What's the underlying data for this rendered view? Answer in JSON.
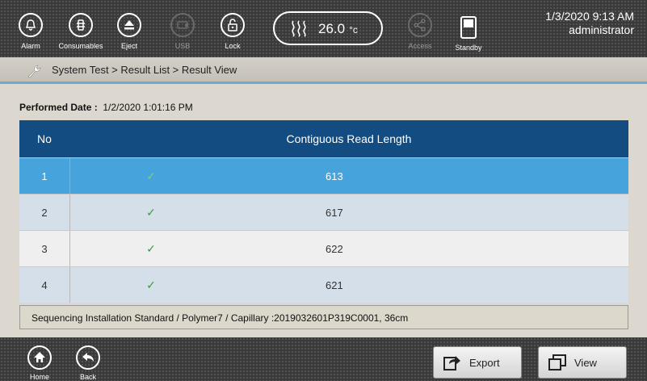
{
  "topbar": {
    "alarm_label": "Alarm",
    "consumables_label": "Consumables",
    "eject_label": "Eject",
    "usb_label": "USB",
    "lock_label": "Lock",
    "temperature_value": "26.0",
    "temperature_unit": "°c",
    "access_label": "Access",
    "standby_label": "Standby",
    "date_time": "1/3/2020 9:13 AM",
    "user": "administrator"
  },
  "breadcrumb": {
    "text": "System Test > Result List > Result View"
  },
  "performed": {
    "label": "Performed Date :",
    "value": "1/2/2020 1:01:16 PM"
  },
  "table": {
    "headers": [
      "No",
      "Contiguous Read Length"
    ],
    "rows": [
      {
        "no": "1",
        "check": "✓",
        "value": "613",
        "selected": true
      },
      {
        "no": "2",
        "check": "✓",
        "value": "617"
      },
      {
        "no": "3",
        "check": "✓",
        "value": "622"
      },
      {
        "no": "4",
        "check": "✓",
        "value": "621"
      }
    ]
  },
  "info": {
    "text": "Sequencing Installation Standard / Polymer7 / Capillary :2019032601P319C0001, 36cm"
  },
  "bottombar": {
    "home_label": "Home",
    "back_label": "Back",
    "export_label": "Export",
    "view_label": "View"
  },
  "colors": {
    "header_blue": "#124c80",
    "selected_row": "#47a3dc",
    "check_green": "#3b9a3b"
  },
  "icons": [
    "alarm-icon",
    "consumables-icon",
    "eject-icon",
    "usb-icon",
    "lock-icon",
    "heat-icon",
    "access-icon",
    "standby-icon",
    "wrench-icon",
    "check-icon",
    "home-icon",
    "back-icon",
    "export-icon",
    "view-icon"
  ]
}
